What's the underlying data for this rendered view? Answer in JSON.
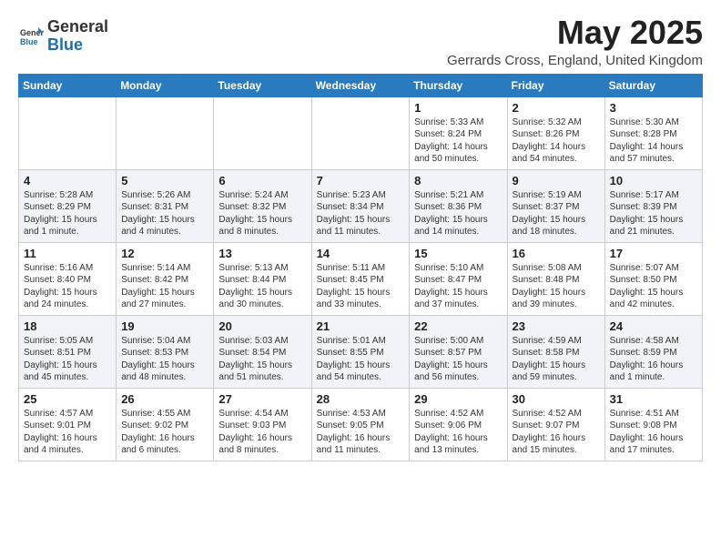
{
  "header": {
    "logo_general": "General",
    "logo_blue": "Blue",
    "month_title": "May 2025",
    "subtitle": "Gerrards Cross, England, United Kingdom"
  },
  "weekdays": [
    "Sunday",
    "Monday",
    "Tuesday",
    "Wednesday",
    "Thursday",
    "Friday",
    "Saturday"
  ],
  "weeks": [
    [
      {
        "day": "",
        "info": ""
      },
      {
        "day": "",
        "info": ""
      },
      {
        "day": "",
        "info": ""
      },
      {
        "day": "",
        "info": ""
      },
      {
        "day": "1",
        "info": "Sunrise: 5:33 AM\nSunset: 8:24 PM\nDaylight: 14 hours\nand 50 minutes."
      },
      {
        "day": "2",
        "info": "Sunrise: 5:32 AM\nSunset: 8:26 PM\nDaylight: 14 hours\nand 54 minutes."
      },
      {
        "day": "3",
        "info": "Sunrise: 5:30 AM\nSunset: 8:28 PM\nDaylight: 14 hours\nand 57 minutes."
      }
    ],
    [
      {
        "day": "4",
        "info": "Sunrise: 5:28 AM\nSunset: 8:29 PM\nDaylight: 15 hours\nand 1 minute."
      },
      {
        "day": "5",
        "info": "Sunrise: 5:26 AM\nSunset: 8:31 PM\nDaylight: 15 hours\nand 4 minutes."
      },
      {
        "day": "6",
        "info": "Sunrise: 5:24 AM\nSunset: 8:32 PM\nDaylight: 15 hours\nand 8 minutes."
      },
      {
        "day": "7",
        "info": "Sunrise: 5:23 AM\nSunset: 8:34 PM\nDaylight: 15 hours\nand 11 minutes."
      },
      {
        "day": "8",
        "info": "Sunrise: 5:21 AM\nSunset: 8:36 PM\nDaylight: 15 hours\nand 14 minutes."
      },
      {
        "day": "9",
        "info": "Sunrise: 5:19 AM\nSunset: 8:37 PM\nDaylight: 15 hours\nand 18 minutes."
      },
      {
        "day": "10",
        "info": "Sunrise: 5:17 AM\nSunset: 8:39 PM\nDaylight: 15 hours\nand 21 minutes."
      }
    ],
    [
      {
        "day": "11",
        "info": "Sunrise: 5:16 AM\nSunset: 8:40 PM\nDaylight: 15 hours\nand 24 minutes."
      },
      {
        "day": "12",
        "info": "Sunrise: 5:14 AM\nSunset: 8:42 PM\nDaylight: 15 hours\nand 27 minutes."
      },
      {
        "day": "13",
        "info": "Sunrise: 5:13 AM\nSunset: 8:44 PM\nDaylight: 15 hours\nand 30 minutes."
      },
      {
        "day": "14",
        "info": "Sunrise: 5:11 AM\nSunset: 8:45 PM\nDaylight: 15 hours\nand 33 minutes."
      },
      {
        "day": "15",
        "info": "Sunrise: 5:10 AM\nSunset: 8:47 PM\nDaylight: 15 hours\nand 37 minutes."
      },
      {
        "day": "16",
        "info": "Sunrise: 5:08 AM\nSunset: 8:48 PM\nDaylight: 15 hours\nand 39 minutes."
      },
      {
        "day": "17",
        "info": "Sunrise: 5:07 AM\nSunset: 8:50 PM\nDaylight: 15 hours\nand 42 minutes."
      }
    ],
    [
      {
        "day": "18",
        "info": "Sunrise: 5:05 AM\nSunset: 8:51 PM\nDaylight: 15 hours\nand 45 minutes."
      },
      {
        "day": "19",
        "info": "Sunrise: 5:04 AM\nSunset: 8:53 PM\nDaylight: 15 hours\nand 48 minutes."
      },
      {
        "day": "20",
        "info": "Sunrise: 5:03 AM\nSunset: 8:54 PM\nDaylight: 15 hours\nand 51 minutes."
      },
      {
        "day": "21",
        "info": "Sunrise: 5:01 AM\nSunset: 8:55 PM\nDaylight: 15 hours\nand 54 minutes."
      },
      {
        "day": "22",
        "info": "Sunrise: 5:00 AM\nSunset: 8:57 PM\nDaylight: 15 hours\nand 56 minutes."
      },
      {
        "day": "23",
        "info": "Sunrise: 4:59 AM\nSunset: 8:58 PM\nDaylight: 15 hours\nand 59 minutes."
      },
      {
        "day": "24",
        "info": "Sunrise: 4:58 AM\nSunset: 8:59 PM\nDaylight: 16 hours\nand 1 minute."
      }
    ],
    [
      {
        "day": "25",
        "info": "Sunrise: 4:57 AM\nSunset: 9:01 PM\nDaylight: 16 hours\nand 4 minutes."
      },
      {
        "day": "26",
        "info": "Sunrise: 4:55 AM\nSunset: 9:02 PM\nDaylight: 16 hours\nand 6 minutes."
      },
      {
        "day": "27",
        "info": "Sunrise: 4:54 AM\nSunset: 9:03 PM\nDaylight: 16 hours\nand 8 minutes."
      },
      {
        "day": "28",
        "info": "Sunrise: 4:53 AM\nSunset: 9:05 PM\nDaylight: 16 hours\nand 11 minutes."
      },
      {
        "day": "29",
        "info": "Sunrise: 4:52 AM\nSunset: 9:06 PM\nDaylight: 16 hours\nand 13 minutes."
      },
      {
        "day": "30",
        "info": "Sunrise: 4:52 AM\nSunset: 9:07 PM\nDaylight: 16 hours\nand 15 minutes."
      },
      {
        "day": "31",
        "info": "Sunrise: 4:51 AM\nSunset: 9:08 PM\nDaylight: 16 hours\nand 17 minutes."
      }
    ]
  ]
}
